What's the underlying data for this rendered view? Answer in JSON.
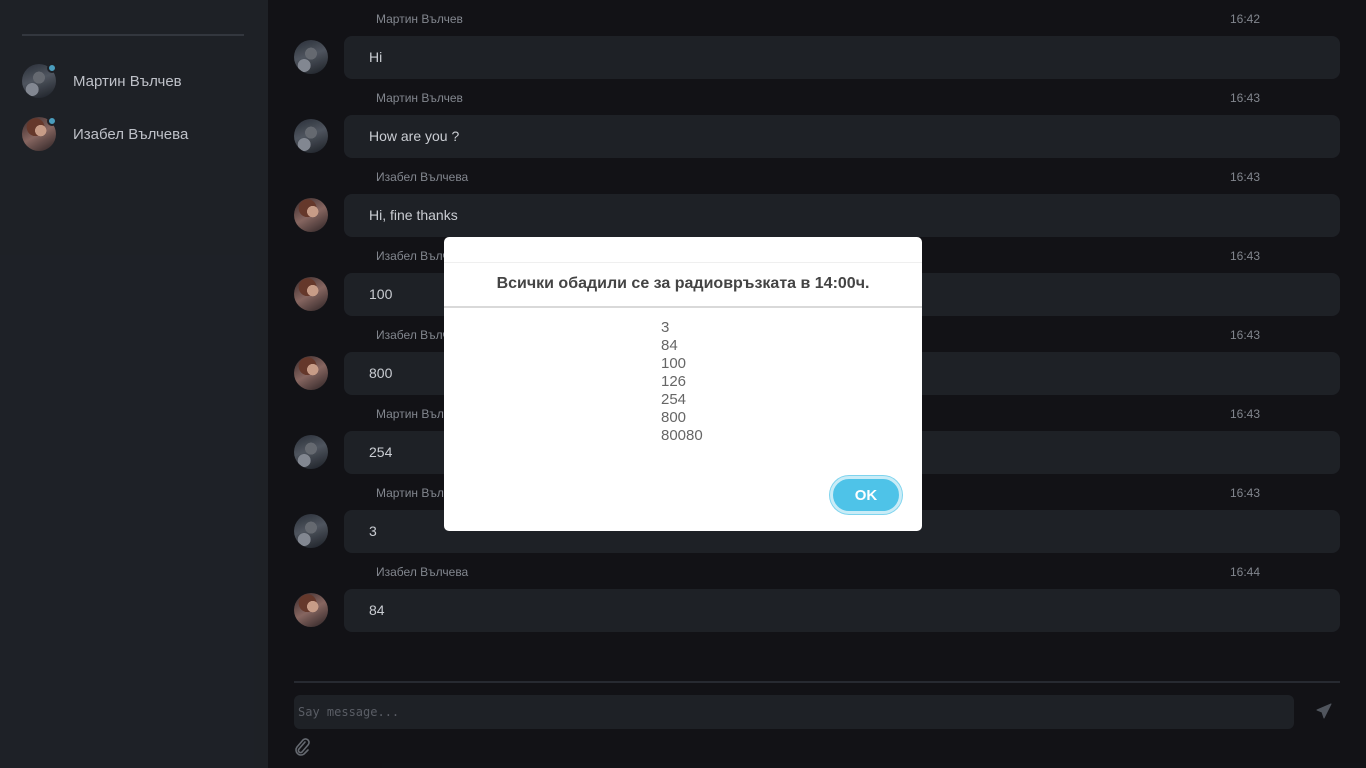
{
  "sidebar": {
    "contacts": [
      {
        "name": "Мартин Вълчев",
        "avatar": "male-avatar"
      },
      {
        "name": "Изабел Вълчева",
        "avatar": "female-avatar"
      }
    ]
  },
  "messages": [
    {
      "author": "Мартин Вълчев",
      "time": "16:42",
      "text": "Hi",
      "avatar": "male-avatar"
    },
    {
      "author": "Мартин Вълчев",
      "time": "16:43",
      "text": "How are you ?",
      "avatar": "male-avatar"
    },
    {
      "author": "Изабел Вълчева",
      "time": "16:43",
      "text": "Hi, fine thanks",
      "avatar": "female-avatar"
    },
    {
      "author": "Изабел Вълчева",
      "time": "16:43",
      "text": "100",
      "avatar": "female-avatar"
    },
    {
      "author": "Изабел Вълчева",
      "time": "16:43",
      "text": "800",
      "avatar": "female-avatar"
    },
    {
      "author": "Мартин Вълчев",
      "time": "16:43",
      "text": "254",
      "avatar": "male-avatar"
    },
    {
      "author": "Мартин Вълчев",
      "time": "16:43",
      "text": "3",
      "avatar": "male-avatar"
    },
    {
      "author": "Изабел Вълчева",
      "time": "16:44",
      "text": "84",
      "avatar": "female-avatar"
    }
  ],
  "composer": {
    "placeholder": "Say message...",
    "send_icon": "send-icon",
    "attach_icon": "paperclip-icon"
  },
  "dialog": {
    "title": "Всички обадили се за радиовръзката в 14:00ч.",
    "items": [
      "3",
      "84",
      "100",
      "126",
      "254",
      "800",
      "80080"
    ],
    "ok_label": "OK"
  },
  "colors": {
    "accent": "#4ec3e8",
    "status_online": "#4fa6c8",
    "background": "#131418",
    "panel": "#202329"
  }
}
